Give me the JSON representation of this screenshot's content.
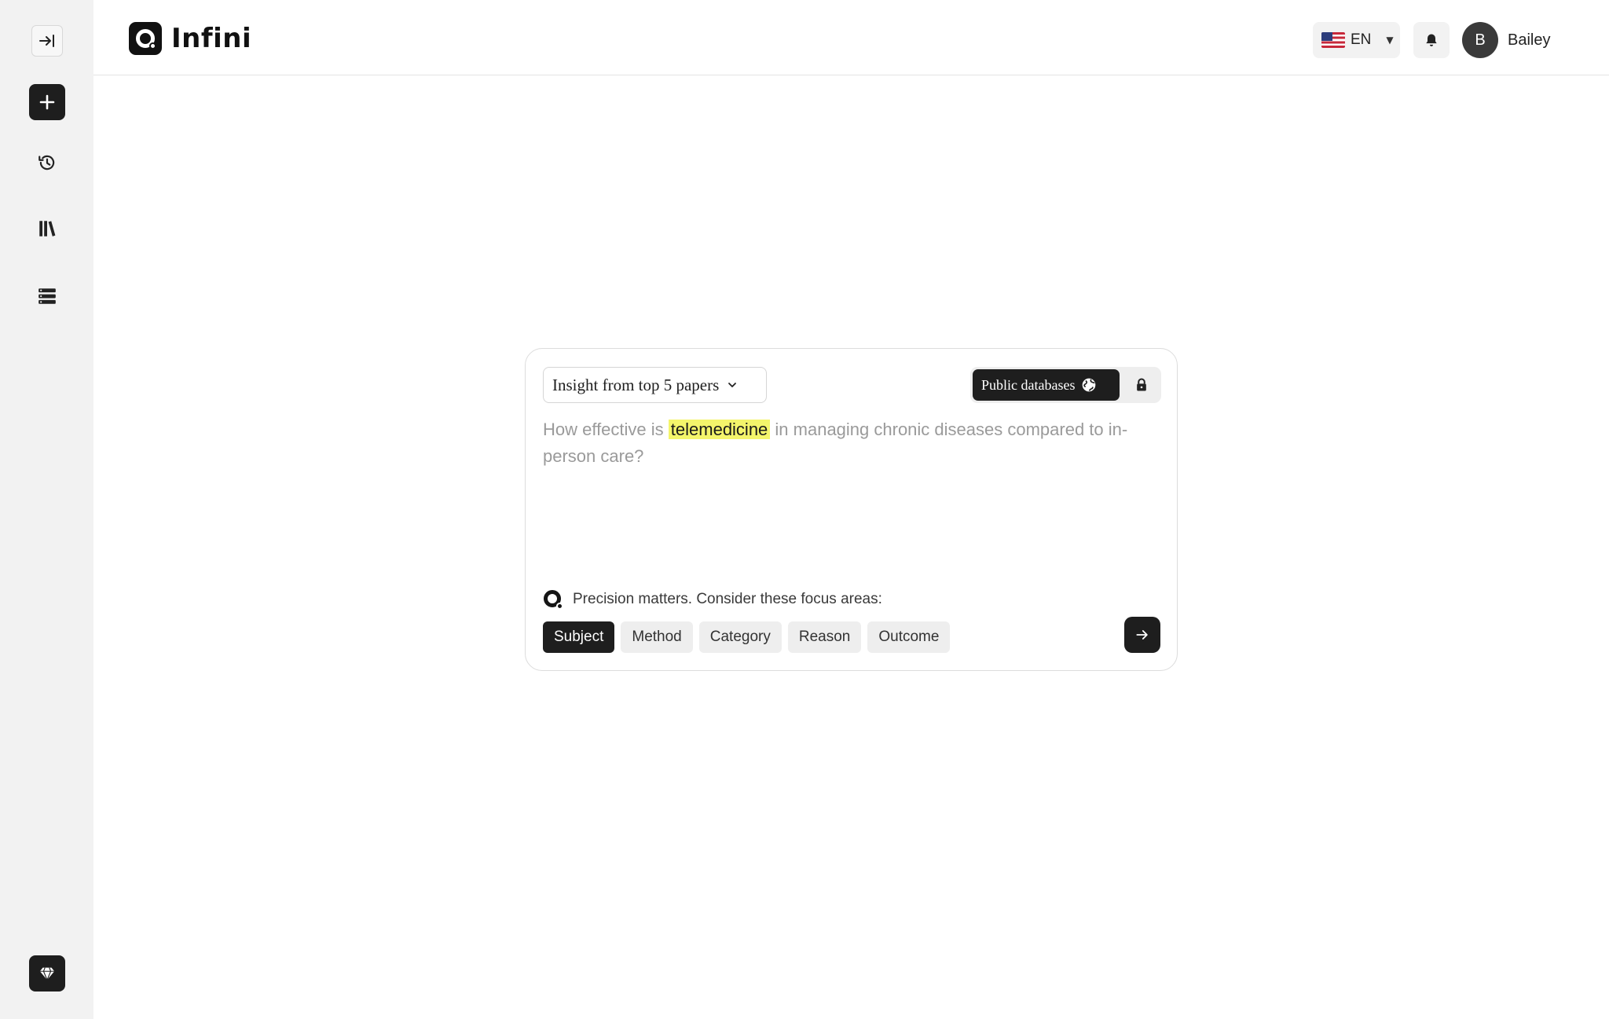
{
  "app": {
    "name": "Infini"
  },
  "sidebar": {
    "items": [
      {
        "id": "collapse",
        "icon": "collapse-sidebar-icon"
      },
      {
        "id": "new",
        "icon": "plus-icon"
      },
      {
        "id": "history",
        "icon": "history-icon"
      },
      {
        "id": "library",
        "icon": "library-icon"
      },
      {
        "id": "list",
        "icon": "list-icon"
      },
      {
        "id": "premium",
        "icon": "diamond-icon"
      }
    ]
  },
  "header": {
    "language": {
      "code": "EN",
      "flag": "us-flag-icon"
    },
    "notifications_icon": "bell-icon",
    "user": {
      "initial": "B",
      "name": "Bailey"
    }
  },
  "search": {
    "mode_label": "Insight from top 5 papers",
    "databases": {
      "public_label": "Public databases",
      "public_icon": "globe-icon",
      "private_icon": "lock-icon"
    },
    "query": {
      "before": "How effective is ",
      "highlight": "telemedicine",
      "after": " in managing chronic diseases compared to in-person care?"
    },
    "hint": "Precision matters. Consider these focus areas:",
    "focus_areas": [
      "Subject",
      "Method",
      "Category",
      "Reason",
      "Outcome"
    ],
    "active_focus": "Subject",
    "submit_icon": "arrow-right-icon"
  },
  "colors": {
    "accent": "#1e1e1e",
    "highlight": "#f4f56b",
    "sidebar_bg": "#f2f2f2"
  }
}
